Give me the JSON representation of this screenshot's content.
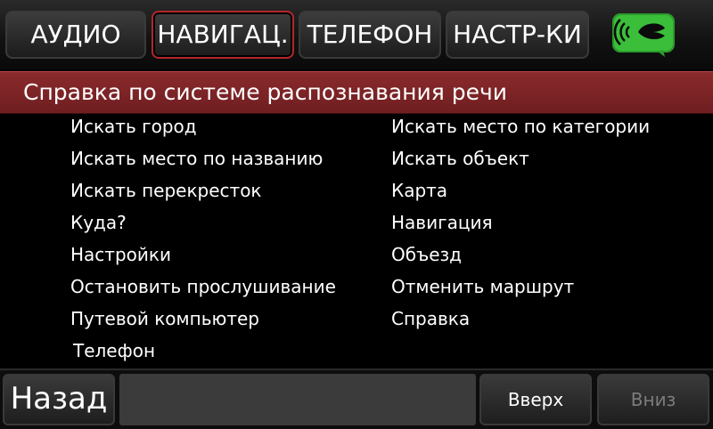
{
  "tabs": [
    {
      "label": "АУДИО",
      "active": false
    },
    {
      "label": "НАВИГАЦ.",
      "active": true
    },
    {
      "label": "ТЕЛЕФОН",
      "active": false
    },
    {
      "label": "НАСТР-КИ",
      "active": false
    }
  ],
  "voice_button": {
    "icon": "voice-speech-icon",
    "color": "#3bbf3b"
  },
  "title": "Справка по системе распознавания речи",
  "commands": {
    "left": [
      "Искать город",
      "Искать место по названию",
      "Искать перекресток",
      "Куда?",
      "Настройки",
      "Остановить прослушивание",
      "Путевой компьютер",
      "Телефон"
    ],
    "right": [
      "Искать место по категории",
      "Искать объект",
      "Карта",
      "Навигация",
      "Объезд",
      "Отменить маршрут",
      "Справка"
    ]
  },
  "bottom": {
    "back_label": "Назад",
    "up_label": "Вверх",
    "down_label": "Вниз",
    "down_disabled": true
  },
  "colors": {
    "accent_red": "#b3262a",
    "title_band": "#7a2326",
    "voice_green": "#3bbf3b"
  }
}
